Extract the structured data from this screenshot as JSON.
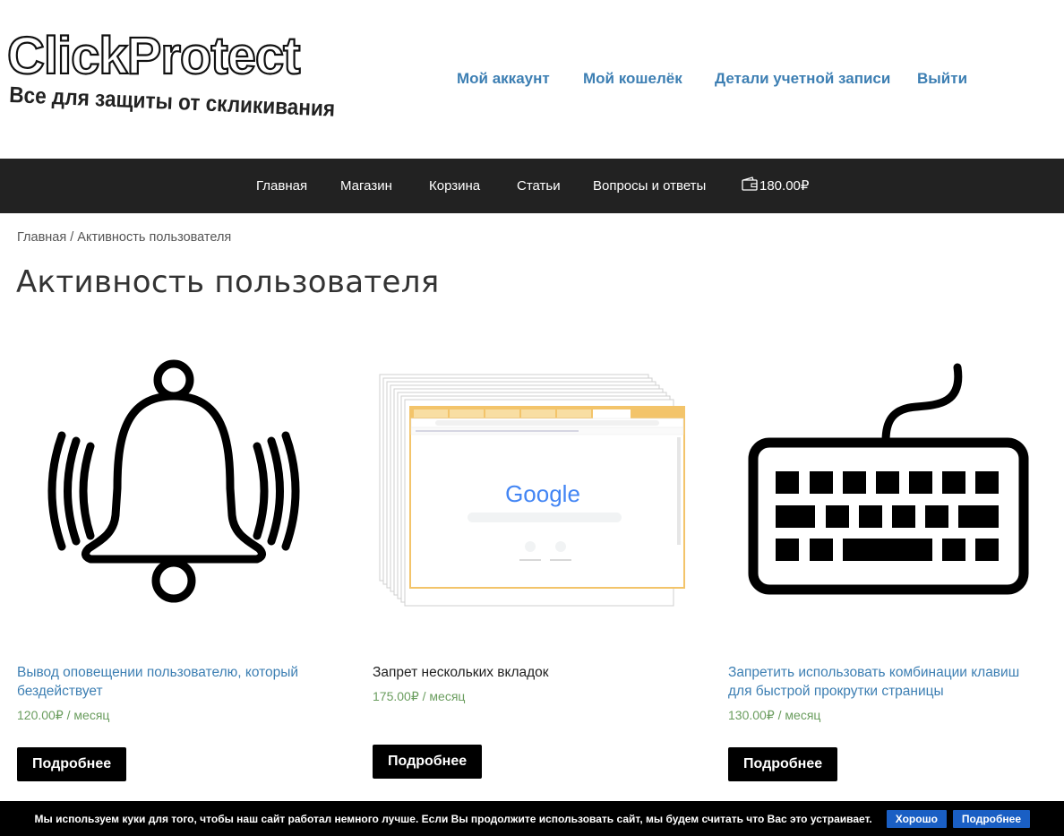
{
  "logo": {
    "title": "ClickProtect",
    "tagline": "Все для защиты от скликивания"
  },
  "account_nav": {
    "items": [
      {
        "label": "Мой аккаунт"
      },
      {
        "label": "Мой кошелёк"
      },
      {
        "label": "Детали учетной записи"
      },
      {
        "label": "Выйти"
      }
    ]
  },
  "main_nav": {
    "items": [
      {
        "label": "Главная"
      },
      {
        "label": "Магазин"
      },
      {
        "label": "Корзина"
      },
      {
        "label": "Статьи"
      },
      {
        "label": "Вопросы и ответы"
      }
    ],
    "wallet_balance": "180.00₽",
    "wallet_icon": "wallet-icon"
  },
  "breadcrumb": {
    "home": "Главная",
    "separator": " / ",
    "current": "Активность пользователя"
  },
  "page_title": "Активность пользователя",
  "products": [
    {
      "title": "Вывод оповещении пользователю, который бездействует",
      "price": "120.00₽",
      "period": " / месяц",
      "button": "Подробнее",
      "image": "bell-icon"
    },
    {
      "title": "Запрет нескольких вкладок",
      "price": "175.00₽",
      "period": " / месяц",
      "button": "Подробнее",
      "image": "browser-tabs-image"
    },
    {
      "title": "Запретить использовать комбинации клавиш для быстрой прокрутки страницы",
      "price": "130.00₽",
      "period": " / месяц",
      "button": "Подробнее",
      "image": "keyboard-icon"
    }
  ],
  "browser_image": {
    "logo_text": "Google"
  },
  "cookie_bar": {
    "message": "Мы используем куки для того, чтобы наш сайт работал немного лучше. Если Вы продолжите использовать сайт, мы будем считать что Вас это устраивает.",
    "accept_label": "Хорошо",
    "more_label": "Подробнее"
  },
  "colors": {
    "link": "#3d7fb3",
    "nav_bg": "#222222",
    "price": "#6a9d5e",
    "cookie_button": "#1a5fc4"
  }
}
